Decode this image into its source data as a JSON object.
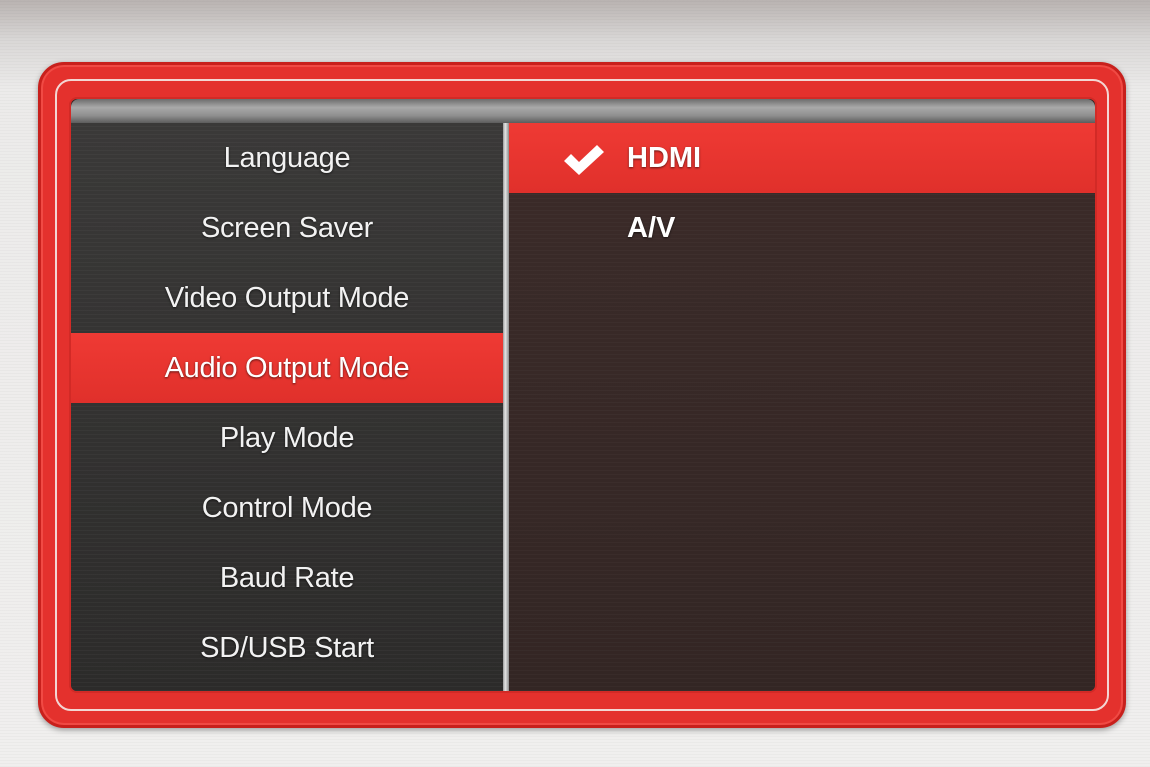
{
  "settings_menu": {
    "items": [
      {
        "label": "Language",
        "selected": false
      },
      {
        "label": "Screen Saver",
        "selected": false
      },
      {
        "label": "Video Output Mode",
        "selected": false
      },
      {
        "label": "Audio Output Mode",
        "selected": true
      },
      {
        "label": "Play Mode",
        "selected": false
      },
      {
        "label": "Control Mode",
        "selected": false
      },
      {
        "label": "Baud Rate",
        "selected": false
      },
      {
        "label": "SD/USB Start",
        "selected": false
      }
    ]
  },
  "options": {
    "items": [
      {
        "label": "HDMI",
        "checked": true,
        "icon": "checkmark-icon"
      },
      {
        "label": "A/V",
        "checked": false
      }
    ]
  },
  "colors": {
    "accent": "#e4312d",
    "panel_left": "#2f2e2d",
    "panel_right": "#362825",
    "text": "#ffffff"
  }
}
